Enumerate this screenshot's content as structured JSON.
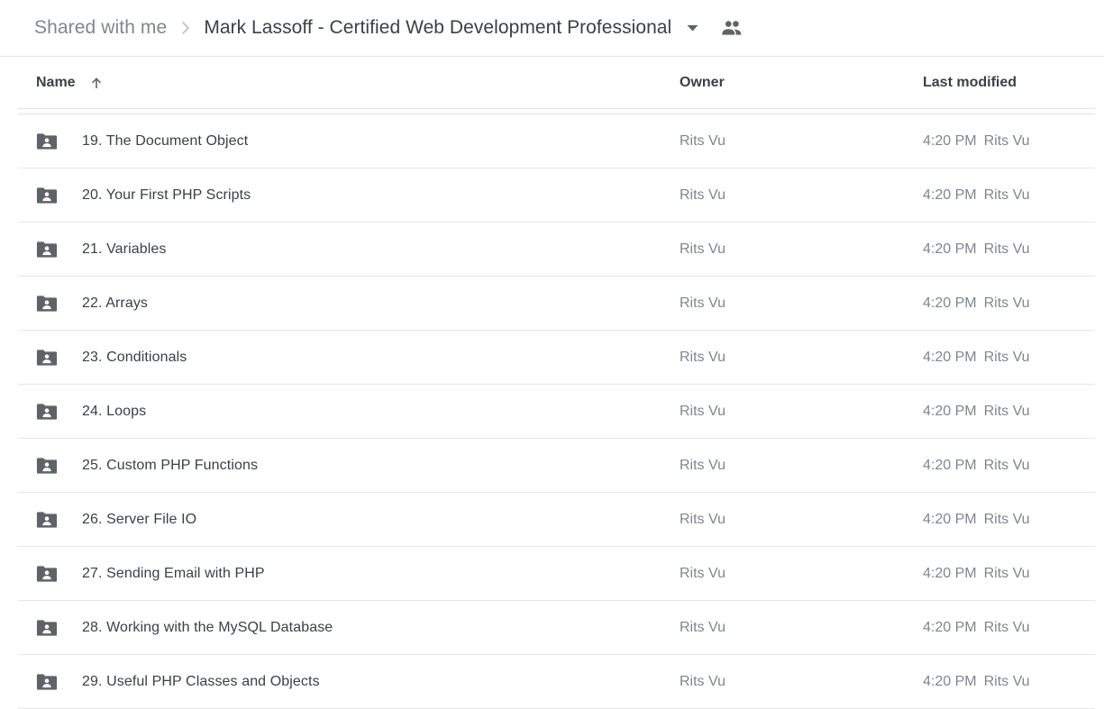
{
  "breadcrumb": {
    "parent": "Shared with me",
    "separator_icon": "chevron-right-icon",
    "current": "Mark Lassoff - Certified Web Development Professional",
    "caret_icon": "caret-down-icon",
    "people_icon": "people-icon"
  },
  "columns": {
    "name": "Name",
    "sort_icon": "arrow-up-icon",
    "owner": "Owner",
    "modified": "Last modified"
  },
  "colors": {
    "folder_icon": "#5f6368",
    "text_primary": "#3c4043",
    "text_secondary": "#80868b",
    "divider": "#e0e0e0",
    "background": "#ffffff"
  },
  "files": [
    {
      "icon": "shared-folder-icon",
      "name": "19. The Document Object",
      "owner": "Rits Vu",
      "modified_time": "4:20 PM",
      "modified_user": "Rits Vu"
    },
    {
      "icon": "shared-folder-icon",
      "name": "20. Your First PHP Scripts",
      "owner": "Rits Vu",
      "modified_time": "4:20 PM",
      "modified_user": "Rits Vu"
    },
    {
      "icon": "shared-folder-icon",
      "name": "21. Variables",
      "owner": "Rits Vu",
      "modified_time": "4:20 PM",
      "modified_user": "Rits Vu"
    },
    {
      "icon": "shared-folder-icon",
      "name": "22. Arrays",
      "owner": "Rits Vu",
      "modified_time": "4:20 PM",
      "modified_user": "Rits Vu"
    },
    {
      "icon": "shared-folder-icon",
      "name": "23. Conditionals",
      "owner": "Rits Vu",
      "modified_time": "4:20 PM",
      "modified_user": "Rits Vu"
    },
    {
      "icon": "shared-folder-icon",
      "name": "24. Loops",
      "owner": "Rits Vu",
      "modified_time": "4:20 PM",
      "modified_user": "Rits Vu"
    },
    {
      "icon": "shared-folder-icon",
      "name": "25. Custom PHP Functions",
      "owner": "Rits Vu",
      "modified_time": "4:20 PM",
      "modified_user": "Rits Vu"
    },
    {
      "icon": "shared-folder-icon",
      "name": "26. Server File IO",
      "owner": "Rits Vu",
      "modified_time": "4:20 PM",
      "modified_user": "Rits Vu"
    },
    {
      "icon": "shared-folder-icon",
      "name": "27. Sending Email with PHP",
      "owner": "Rits Vu",
      "modified_time": "4:20 PM",
      "modified_user": "Rits Vu"
    },
    {
      "icon": "shared-folder-icon",
      "name": "28. Working with the MySQL Database",
      "owner": "Rits Vu",
      "modified_time": "4:20 PM",
      "modified_user": "Rits Vu"
    },
    {
      "icon": "shared-folder-icon",
      "name": "29. Useful PHP Classes and Objects",
      "owner": "Rits Vu",
      "modified_time": "4:20 PM",
      "modified_user": "Rits Vu"
    }
  ]
}
